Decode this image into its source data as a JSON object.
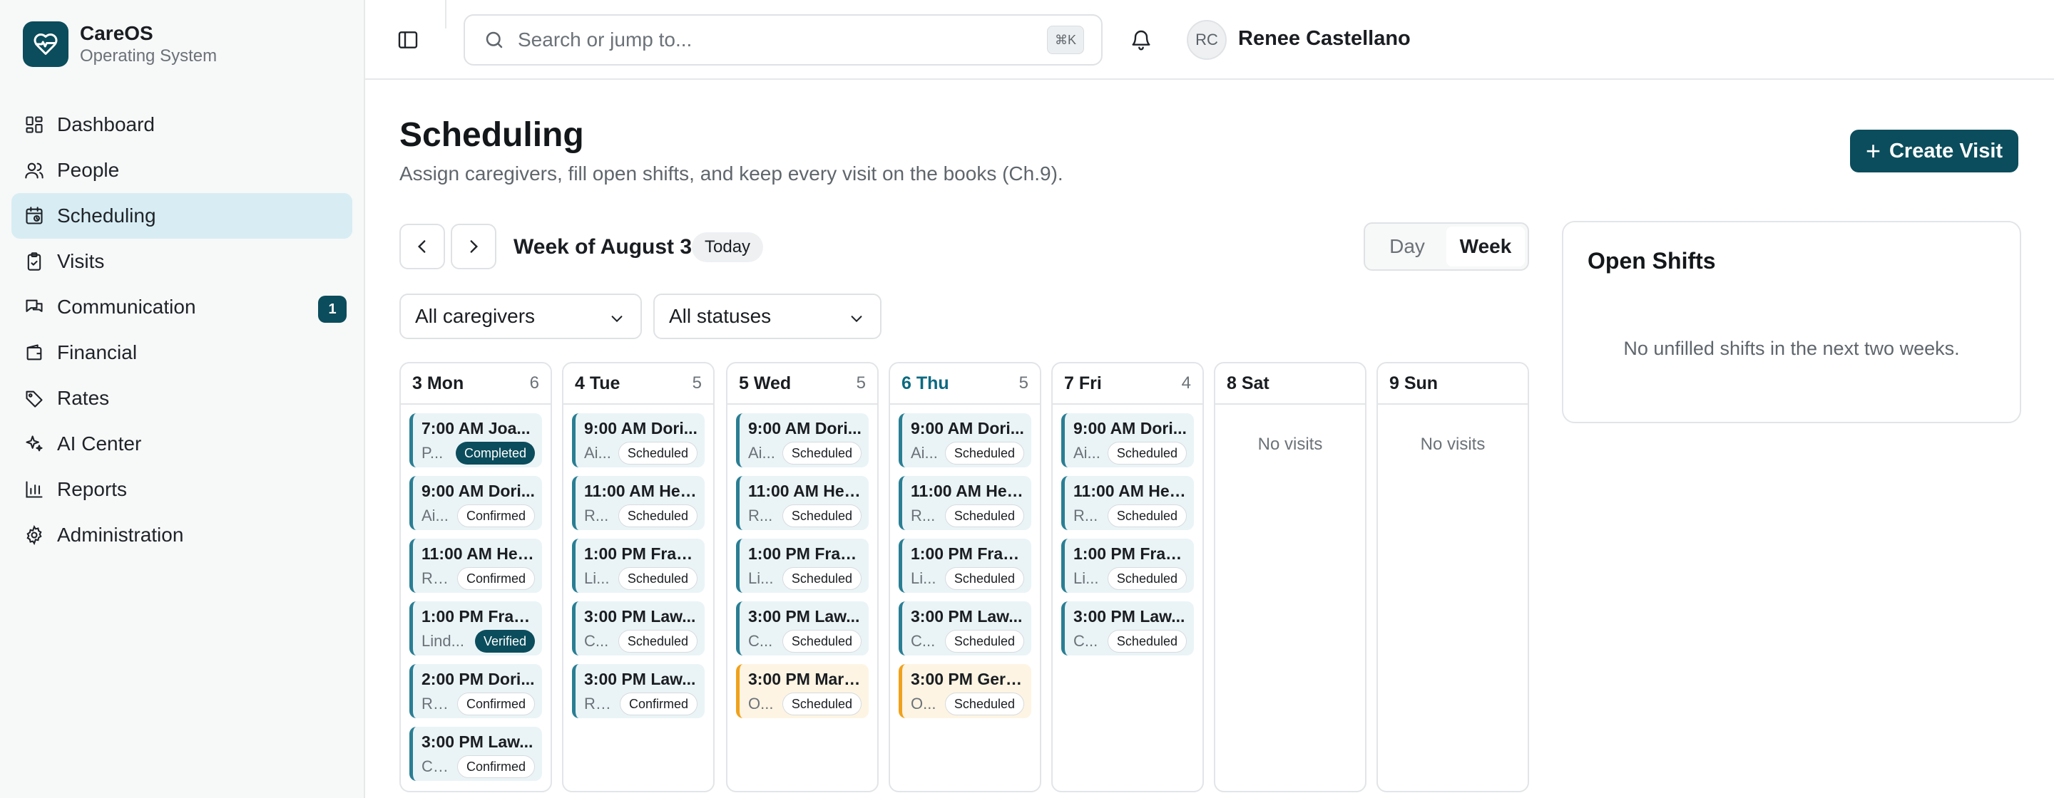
{
  "brand": {
    "name": "CareOS",
    "subtitle": "Operating System"
  },
  "sidebar": {
    "items": [
      {
        "label": "Dashboard",
        "icon": "dashboard-icon"
      },
      {
        "label": "People",
        "icon": "people-icon"
      },
      {
        "label": "Scheduling",
        "icon": "calendar-icon",
        "active": true
      },
      {
        "label": "Visits",
        "icon": "clipboard-icon"
      },
      {
        "label": "Communication",
        "icon": "chat-icon",
        "badge": "1"
      },
      {
        "label": "Financial",
        "icon": "wallet-icon"
      },
      {
        "label": "Rates",
        "icon": "tag-icon"
      },
      {
        "label": "AI Center",
        "icon": "sparkles-icon"
      },
      {
        "label": "Reports",
        "icon": "bar-chart-icon"
      },
      {
        "label": "Administration",
        "icon": "gear-icon"
      }
    ]
  },
  "topbar": {
    "search_placeholder": "Search or jump to...",
    "shortcut": "⌘K",
    "user": {
      "initials": "RC",
      "name": "Renee Castellano"
    }
  },
  "page": {
    "title": "Scheduling",
    "subtitle": "Assign caregivers, fill open shifts, and keep every visit on the books (Ch.9).",
    "create_label": "Create Visit"
  },
  "week": {
    "label": "Week of August 3",
    "today_label": "Today",
    "views": [
      "Day",
      "Week"
    ],
    "active_view": "Week"
  },
  "filters": {
    "caregivers": "All caregivers",
    "statuses": "All statuses"
  },
  "colors": {
    "accent": "#0b4d5c",
    "visit_bg": "#eaf4f7",
    "visit_border": "#2a7e93",
    "visit_orange_bg": "#fdf4e3",
    "visit_orange_border": "#f0a11b"
  },
  "days": [
    {
      "name": "3 Mon",
      "count": "6",
      "visits": [
        {
          "title": "7:00 AM Joa...",
          "person": "P...",
          "status": "Completed",
          "style": "dark"
        },
        {
          "title": "9:00 AM Dori...",
          "person": "Ai...",
          "status": "Confirmed",
          "style": "light"
        },
        {
          "title": "11:00 AM Her...",
          "person": "Ro...",
          "status": "Confirmed",
          "style": "light"
        },
        {
          "title": "1:00 PM Fran...",
          "person": "Lind...",
          "status": "Verified",
          "style": "dark"
        },
        {
          "title": "2:00 PM Dori...",
          "person": "Ro...",
          "status": "Confirmed",
          "style": "light"
        },
        {
          "title": "3:00 PM Law...",
          "person": "Ca...",
          "status": "Confirmed",
          "style": "light"
        }
      ]
    },
    {
      "name": "4 Tue",
      "count": "5",
      "visits": [
        {
          "title": "9:00 AM Dori...",
          "person": "Ai...",
          "status": "Scheduled",
          "style": "light"
        },
        {
          "title": "11:00 AM Her...",
          "person": "R...",
          "status": "Scheduled",
          "style": "light"
        },
        {
          "title": "1:00 PM Fran...",
          "person": "Li...",
          "status": "Scheduled",
          "style": "light"
        },
        {
          "title": "3:00 PM Law...",
          "person": "C...",
          "status": "Scheduled",
          "style": "light"
        },
        {
          "title": "3:00 PM Law...",
          "person": "Ro...",
          "status": "Confirmed",
          "style": "light"
        }
      ]
    },
    {
      "name": "5 Wed",
      "count": "5",
      "visits": [
        {
          "title": "9:00 AM Dori...",
          "person": "Ai...",
          "status": "Scheduled",
          "style": "light"
        },
        {
          "title": "11:00 AM Her...",
          "person": "R...",
          "status": "Scheduled",
          "style": "light"
        },
        {
          "title": "1:00 PM Fran...",
          "person": "Li...",
          "status": "Scheduled",
          "style": "light"
        },
        {
          "title": "3:00 PM Law...",
          "person": "C...",
          "status": "Scheduled",
          "style": "light"
        },
        {
          "title": "3:00 PM Marj...",
          "person": "O...",
          "status": "Scheduled",
          "style": "light",
          "orange": true
        }
      ]
    },
    {
      "name": "6 Thu",
      "count": "5",
      "today": true,
      "visits": [
        {
          "title": "9:00 AM Dori...",
          "person": "Ai...",
          "status": "Scheduled",
          "style": "light"
        },
        {
          "title": "11:00 AM Her...",
          "person": "R...",
          "status": "Scheduled",
          "style": "light"
        },
        {
          "title": "1:00 PM Fran...",
          "person": "Li...",
          "status": "Scheduled",
          "style": "light"
        },
        {
          "title": "3:00 PM Law...",
          "person": "C...",
          "status": "Scheduled",
          "style": "light"
        },
        {
          "title": "3:00 PM Gera...",
          "person": "O...",
          "status": "Scheduled",
          "style": "light",
          "orange": true
        }
      ]
    },
    {
      "name": "7 Fri",
      "count": "4",
      "visits": [
        {
          "title": "9:00 AM Dori...",
          "person": "Ai...",
          "status": "Scheduled",
          "style": "light"
        },
        {
          "title": "11:00 AM Her...",
          "person": "R...",
          "status": "Scheduled",
          "style": "light"
        },
        {
          "title": "1:00 PM Fran...",
          "person": "Li...",
          "status": "Scheduled",
          "style": "light"
        },
        {
          "title": "3:00 PM Law...",
          "person": "C...",
          "status": "Scheduled",
          "style": "light"
        }
      ]
    },
    {
      "name": "8 Sat",
      "count": "",
      "visits": [],
      "empty": "No visits"
    },
    {
      "name": "9 Sun",
      "count": "",
      "visits": [],
      "empty": "No visits"
    }
  ],
  "open_shifts": {
    "title": "Open Shifts",
    "empty": "No unfilled shifts in the next two weeks."
  }
}
